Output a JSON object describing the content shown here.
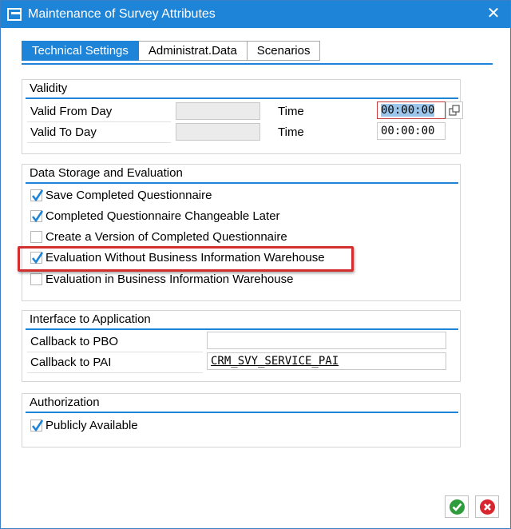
{
  "window": {
    "title": "Maintenance of Survey Attributes"
  },
  "tabs": [
    {
      "label": "Technical Settings",
      "active": true
    },
    {
      "label": "Administrat.Data",
      "active": false
    },
    {
      "label": "Scenarios",
      "active": false
    }
  ],
  "validity": {
    "title": "Validity",
    "valid_from_label": "Valid From Day",
    "valid_from_value": "",
    "valid_to_label": "Valid To Day",
    "valid_to_value": "",
    "time_label_1": "Time",
    "time_value_1": "00:00:00",
    "time_label_2": "Time",
    "time_value_2": "00:00:00"
  },
  "storage": {
    "title": "Data Storage and Evaluation",
    "options": [
      {
        "label": "Save Completed Questionnaire",
        "checked": true
      },
      {
        "label": "Completed Questionnaire Changeable Later",
        "checked": true
      },
      {
        "label": "Create a Version of Completed Questionnaire",
        "checked": false
      },
      {
        "label": "Evaluation Without Business Information Warehouse",
        "checked": true
      },
      {
        "label": "Evaluation in Business Information Warehouse",
        "checked": false
      }
    ]
  },
  "interface": {
    "title": "Interface to Application",
    "pbo_label": "Callback to PBO",
    "pbo_value": "",
    "pai_label": "Callback to PAI",
    "pai_value": "CRM_SVY_SERVICE_PAI"
  },
  "authorization": {
    "title": "Authorization",
    "public_label": "Publicly Available",
    "public_checked": true
  },
  "colors": {
    "accent": "#1e84d7",
    "highlight": "#d32f2f",
    "ok": "#2e9b3c",
    "cancel": "#d8262e"
  },
  "icons": {
    "title": "sap-menu-icon",
    "close": "close-icon",
    "value_help": "value-help-icon",
    "ok": "check-circle-icon",
    "cancel": "cancel-circle-icon"
  }
}
